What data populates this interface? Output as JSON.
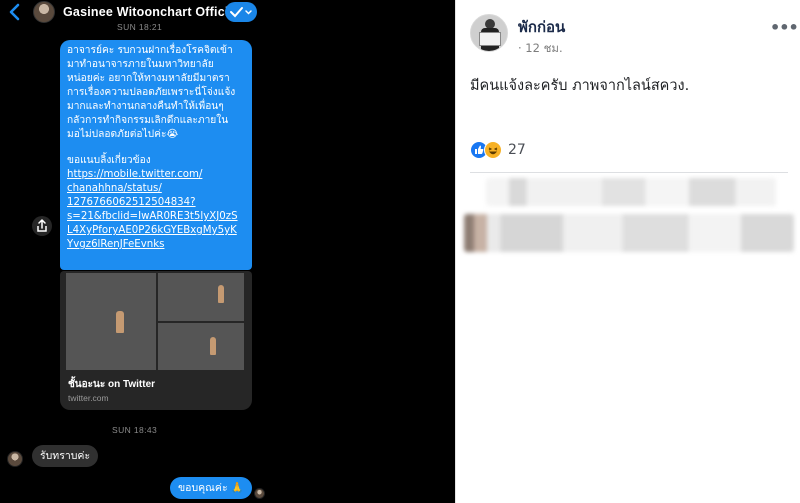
{
  "chat": {
    "header": {
      "name": "Gasinee Witoonchart Official",
      "back_icon": "chevron-left-icon",
      "verified_icon": "check-chevron-icon"
    },
    "timestamp_1": "SUN 18:21",
    "timestamp_2": "SUN 18:43",
    "message_1": {
      "text": "อาจารย์คะ รบกวนฝากเรื่องโรคจิตเข้า\nมาทำอนาจารภายในมหาวิทยาลัย\nหน่อยค่ะ อยากให้ทางมหาลัยมีมาตรา\nการเรื่องความปลอดภัยเพราะนี่โจ่งแจ้ง\nมากและทำงานกลางคืนทำให้เพื่อนๆ\nกลัวการทำกิจกรรมเลิกดึกและภายใน\nมอไม่ปลอดภัยต่อไปค่ะ😭",
      "sub": "ขอแนบลิ้งเกี่ยวข้อง",
      "link": "https://mobile.twitter.com/\nchanahhna/status/\n1276766062512504834?\ns=21&fbclid=IwAR0RE3t5lyXJ0zS\nL4XyPforyAE0P26kGYEBxgMy5yK\nYvgz6lRenJFeEvnks"
    },
    "link_card": {
      "title": "ชั้นอะนะ on Twitter",
      "domain": "twitter.com"
    },
    "reply": "รับทราบค่ะ",
    "my_message": "ขอบคุณค่ะ 🙏",
    "share_icon": "share-icon"
  },
  "post": {
    "page_name": "พักก่อน",
    "meta": "· 12 ชม.",
    "more": "•••",
    "text": "มีคนแจ้งละครับ ภาพจากไลน์สควง.",
    "reaction_count": "27",
    "reactions": [
      "like-icon",
      "haha-icon"
    ]
  },
  "colors": {
    "messenger_blue": "#1d8df1",
    "dark_bg": "#000000",
    "fb_like": "#1877f2",
    "fb_haha": "#f7b125"
  }
}
